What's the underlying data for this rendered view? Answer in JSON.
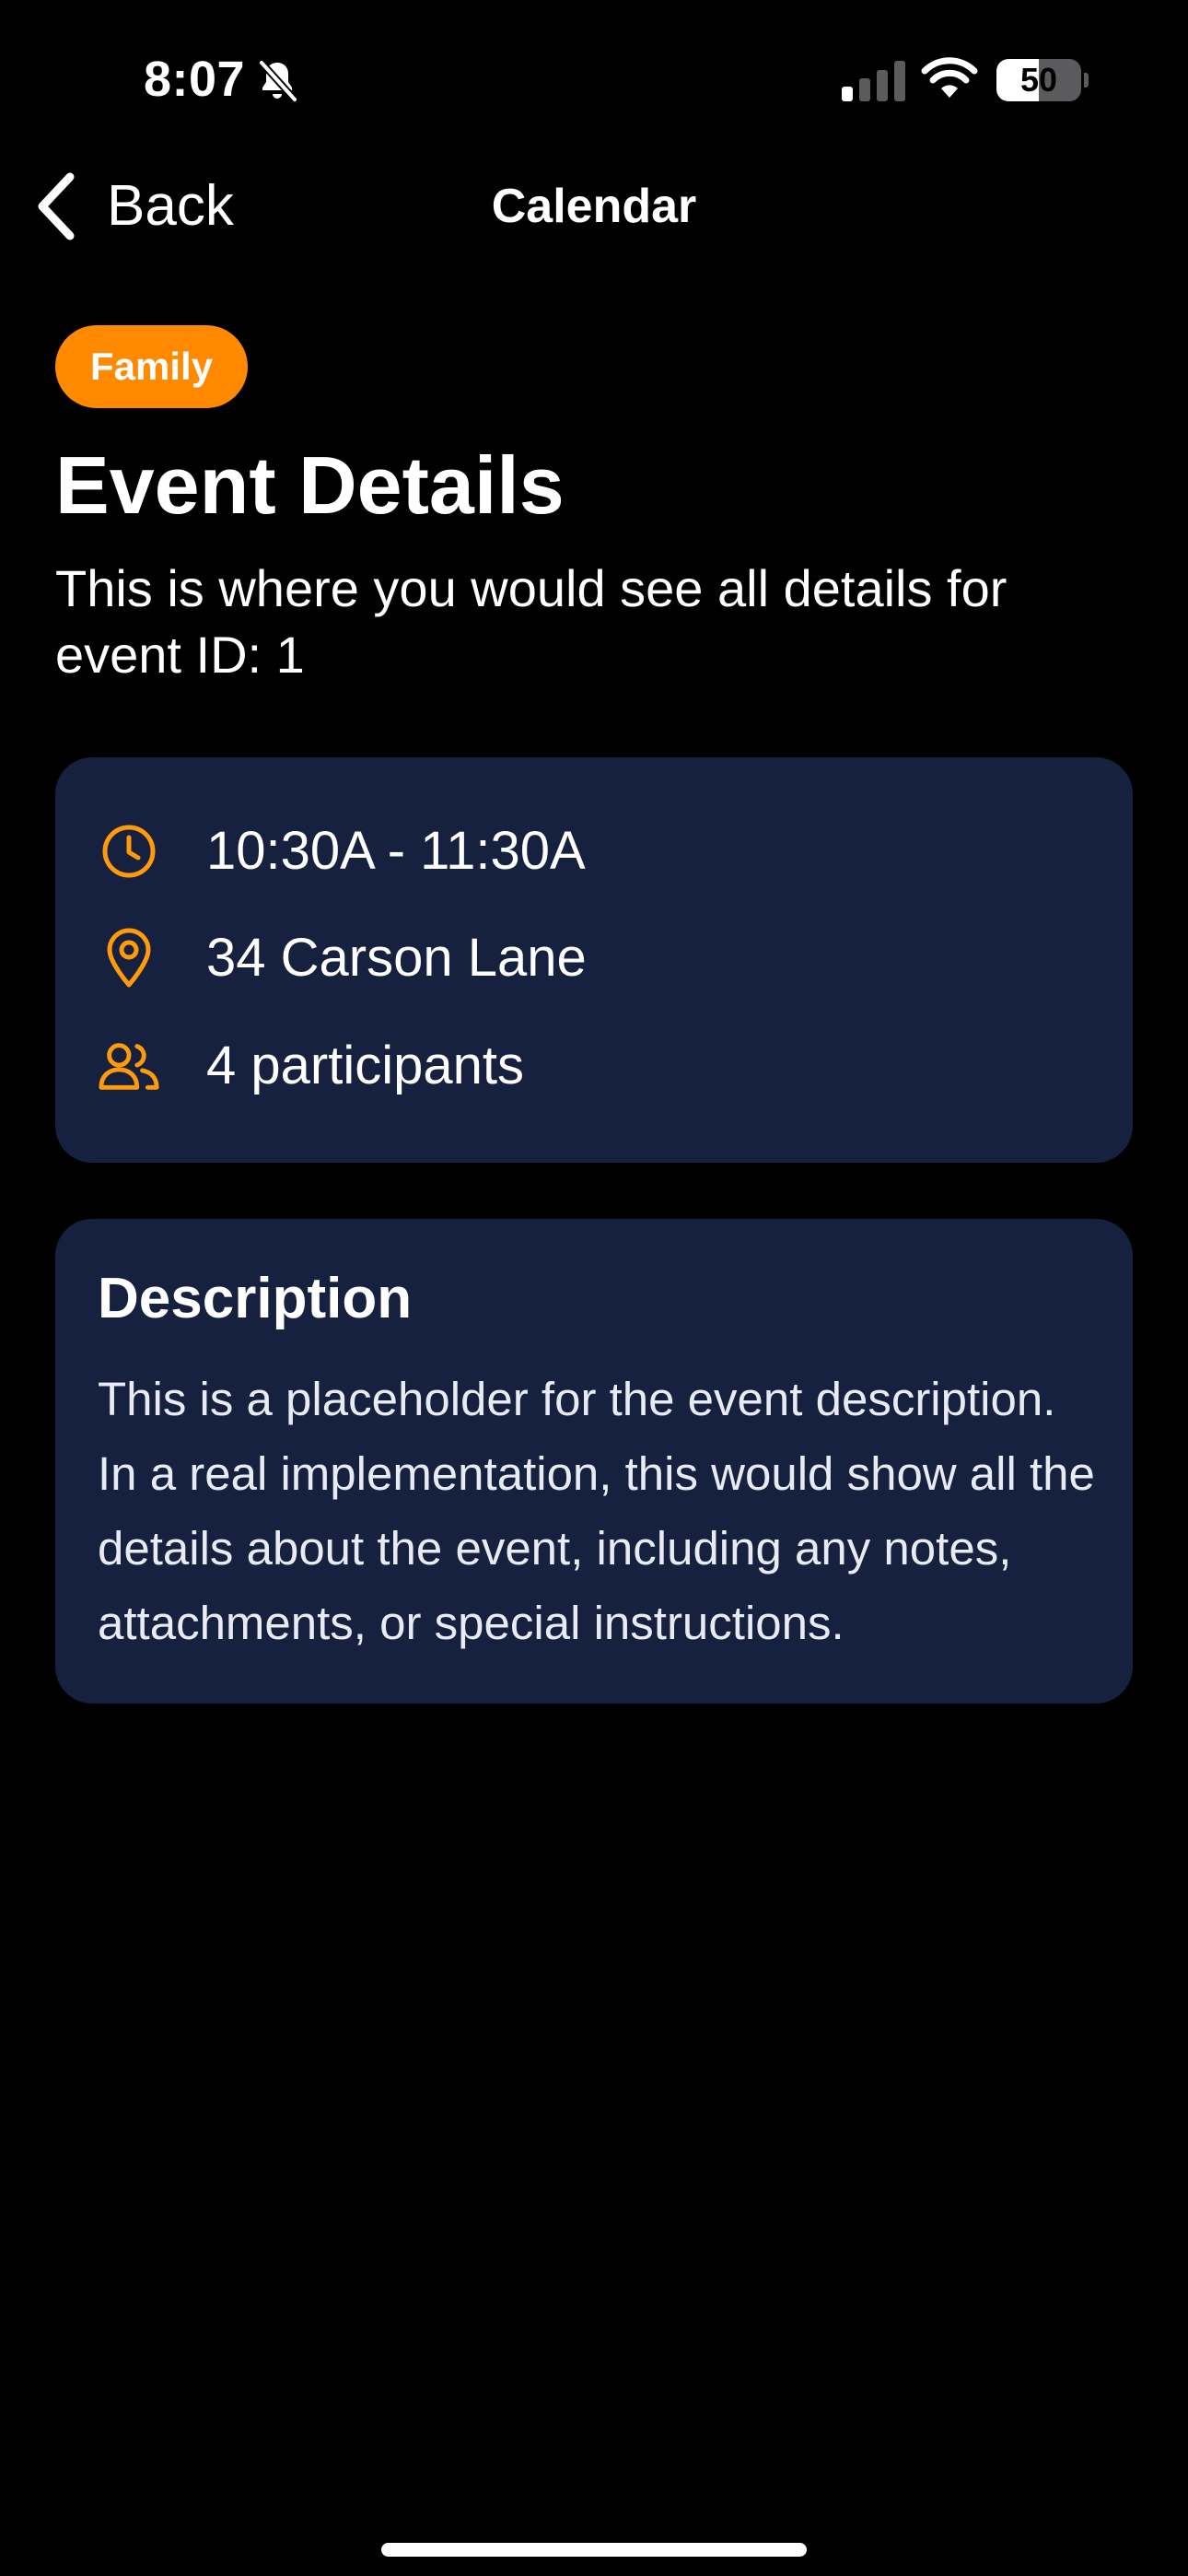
{
  "status_bar": {
    "time": "8:07",
    "battery_level": "50",
    "battery_fraction": 0.5
  },
  "nav": {
    "back_label": "Back",
    "title": "Calendar"
  },
  "event": {
    "category": "Family",
    "category_color": "#ff8a00",
    "title": "Event Details",
    "subtitle": "This is where you would see all details for event ID: 1",
    "time": "10:30A - 11:30A",
    "location": "34 Carson Lane",
    "participants": "4 participants",
    "icons": {
      "time": "clock-icon",
      "location": "map-pin-icon",
      "participants": "users-icon"
    },
    "accent_color": "#ff9a0d",
    "card_color": "#15213f"
  },
  "description": {
    "heading": "Description",
    "body": "This is a placeholder for the event description. In a real implementation, this would show all the details about the event, including any notes, attachments, or special instructions."
  }
}
